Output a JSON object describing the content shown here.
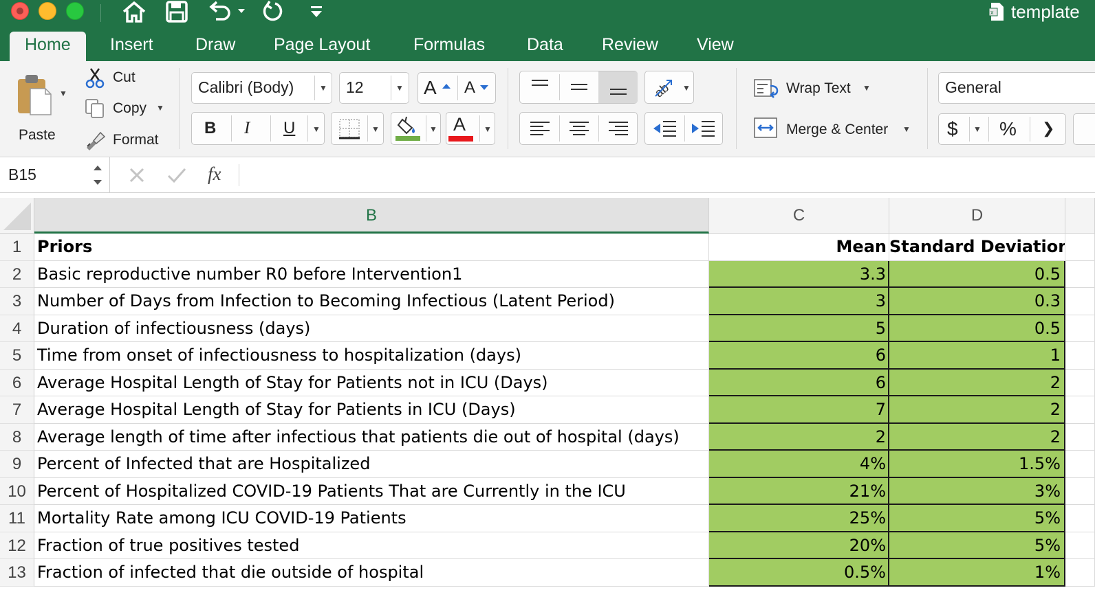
{
  "window": {
    "title": "template",
    "colors": {
      "brand": "#217346",
      "ribbon_bg": "#f3f3f3",
      "cell_fill": "#a1cc62"
    }
  },
  "quick_access": [
    "home-icon",
    "save-icon",
    "undo-icon",
    "redo-icon",
    "customize-icon"
  ],
  "tabs": [
    {
      "label": "Home",
      "active": true
    },
    {
      "label": "Insert"
    },
    {
      "label": "Draw"
    },
    {
      "label": "Page Layout"
    },
    {
      "label": "Formulas"
    },
    {
      "label": "Data"
    },
    {
      "label": "Review"
    },
    {
      "label": "View"
    }
  ],
  "ribbon": {
    "clipboard": {
      "paste": "Paste",
      "cut": "Cut",
      "copy": "Copy",
      "format": "Format"
    },
    "font": {
      "name": "Calibri (Body)",
      "size": "12",
      "bold": "B",
      "italic": "I",
      "underline": "U",
      "grow": "A",
      "shrink": "A",
      "font_color_glyph": "A",
      "fill_color": "#70ad47",
      "font_color": "#e8171b"
    },
    "alignment": {
      "wrap_text": "Wrap Text",
      "merge_center": "Merge & Center"
    },
    "number": {
      "format": "General",
      "currency": "$",
      "percent": "%",
      "comma": "❯"
    }
  },
  "formula_bar": {
    "name_box": "B15",
    "fx": "fx",
    "value": ""
  },
  "grid": {
    "columns": [
      "B",
      "C",
      "D"
    ],
    "selected_column": "B",
    "rows": [
      {
        "num": "1",
        "b": "Priors",
        "c": "Mean",
        "d": "Standard Deviation"
      },
      {
        "num": "2",
        "b": "Basic reproductive number R0 before Intervention1",
        "c": "3.3",
        "d": "0.5"
      },
      {
        "num": "3",
        "b": "Number of Days from Infection to Becoming Infectious (Latent Period)",
        "c": "3",
        "d": "0.3"
      },
      {
        "num": "4",
        "b": "Duration of infectiousness (days)",
        "c": "5",
        "d": "0.5"
      },
      {
        "num": "5",
        "b": "Time from onset of infectiousness to hospitalization (days)",
        "c": "6",
        "d": "1"
      },
      {
        "num": "6",
        "b": "Average Hospital Length of Stay for Patients not in ICU (Days)",
        "c": "6",
        "d": "2"
      },
      {
        "num": "7",
        "b": "Average Hospital Length of Stay for Patients in ICU (Days)",
        "c": "7",
        "d": "2"
      },
      {
        "num": "8",
        "b": "Average length of time after infectious that patients die out of hospital (days)",
        "c": "2",
        "d": "2"
      },
      {
        "num": "9",
        "b": "Percent of Infected that are Hospitalized",
        "c": "4%",
        "d": "1.5%"
      },
      {
        "num": "10",
        "b": "Percent of Hospitalized COVID-19 Patients That are Currently in the ICU",
        "c": "21%",
        "d": "3%"
      },
      {
        "num": "11",
        "b": "Mortality Rate among ICU COVID-19 Patients",
        "c": "25%",
        "d": "5%"
      },
      {
        "num": "12",
        "b": "Fraction of true positives tested",
        "c": "20%",
        "d": "5%"
      },
      {
        "num": "13",
        "b": "Fraction of infected that die outside of hospital",
        "c": "0.5%",
        "d": "1%"
      }
    ]
  }
}
